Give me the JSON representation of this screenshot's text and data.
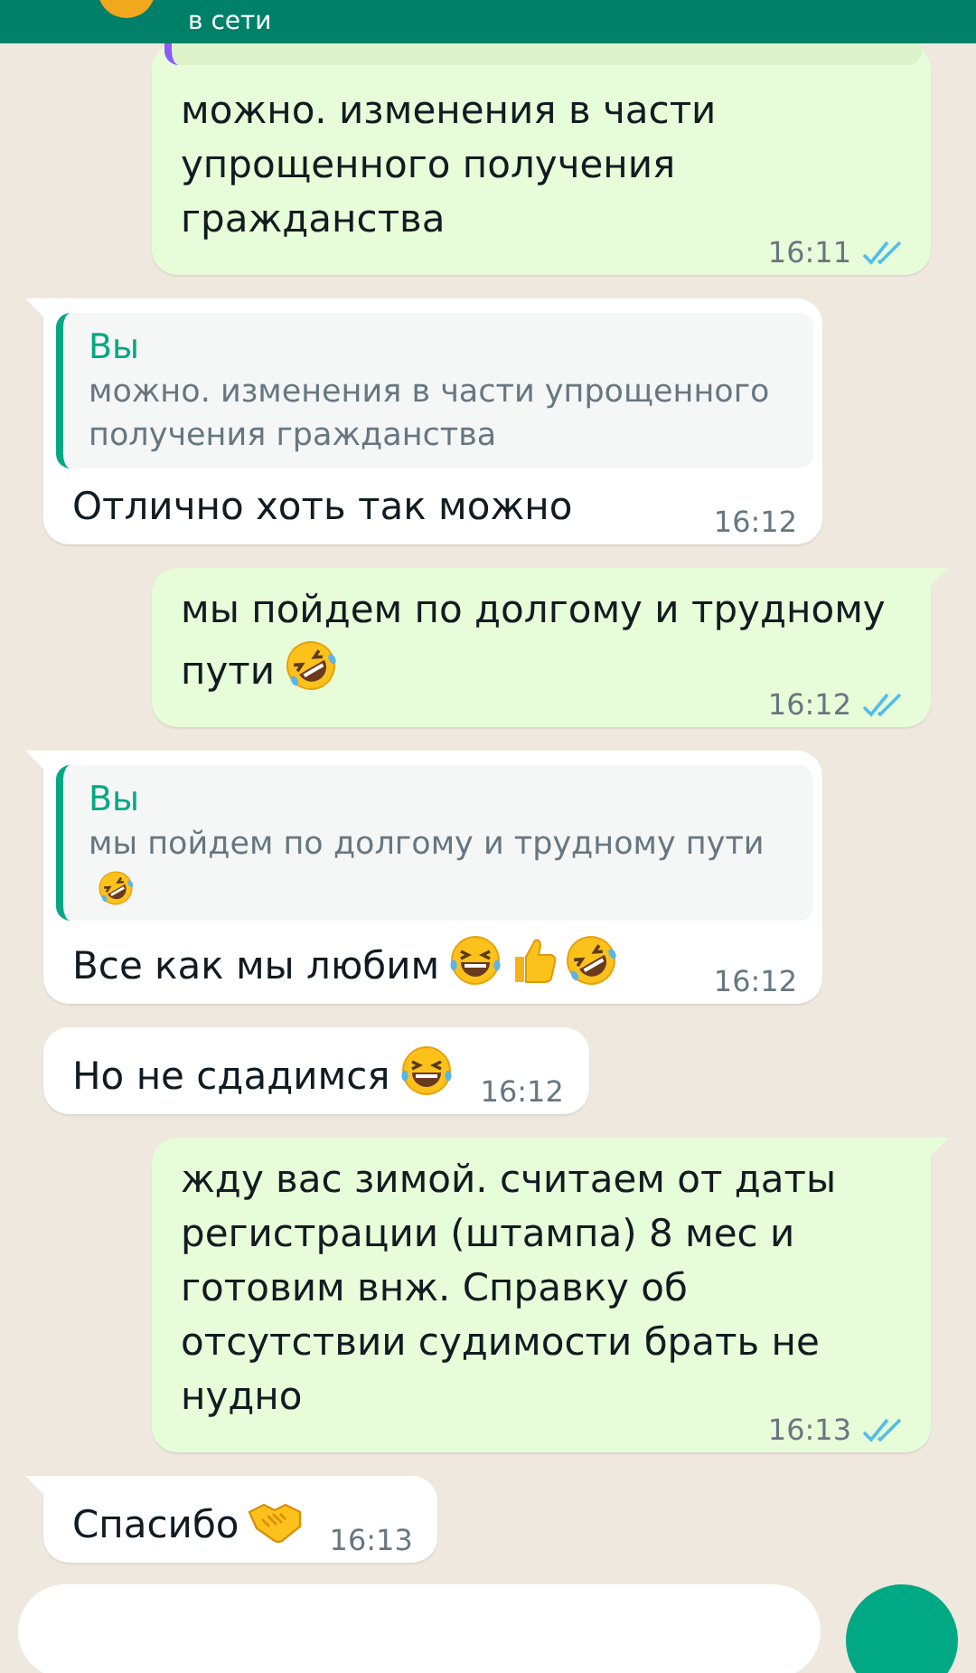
{
  "header": {
    "status": "в сети"
  },
  "messages": [
    {
      "kind": "outgoing",
      "quote_stub": true,
      "text": "можно. изменения в части упрощенного получения гражданства",
      "time": "16:11",
      "read": true,
      "tail": false
    },
    {
      "kind": "incoming",
      "quote": {
        "author": "Вы",
        "text": "можно. изменения в части упрощенного получения гражданства"
      },
      "text": "Отлично хоть так можно",
      "time": "16:12",
      "tail": true
    },
    {
      "kind": "outgoing",
      "text": "мы пойдем по долгому и трудному пути",
      "emojis": [
        {
          "kind": "rofl"
        }
      ],
      "time": "16:12",
      "read": true,
      "tail": true
    },
    {
      "kind": "incoming",
      "quote": {
        "author": "Вы",
        "text": "мы пойдем по долгому и трудному пути",
        "emojis": [
          {
            "kind": "rofl"
          }
        ]
      },
      "text": "Все как мы любим",
      "emojis": [
        {
          "kind": "joy"
        },
        {
          "kind": "thumbs-up"
        },
        {
          "kind": "rofl"
        }
      ],
      "time": "16:12",
      "tail": true
    },
    {
      "kind": "incoming",
      "text": "Но не сдадимся",
      "emojis": [
        {
          "kind": "joy"
        }
      ],
      "time": "16:12",
      "tail": false
    },
    {
      "kind": "outgoing",
      "text": "жду вас зимой. считаем от даты регистрации (штампа) 8 мес и готовим внж. Справку об отсутствии судимости брать не нудно",
      "time": "16:13",
      "read": true,
      "tail": true
    },
    {
      "kind": "incoming",
      "text": "Спасибо",
      "emojis": [
        {
          "kind": "handshake"
        }
      ],
      "time": "16:13",
      "tail": true
    }
  ]
}
